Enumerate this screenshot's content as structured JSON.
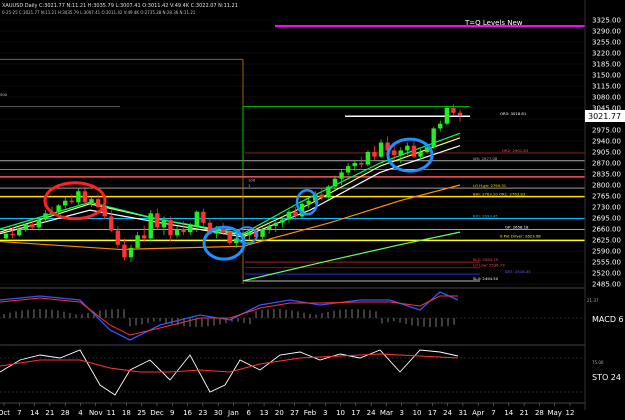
{
  "header": {
    "line1": "XAUUSD Daily C:3021.77 N:11.21 H:3035.79 L:3007.41 O:3011.42 V:49.4K C:3022.07 N:11.21",
    "line2": "0-25-25 C:3021.77 N:11.21 H:3035.79 L:3007.41 O:3011.42 V:49.4K O:2735.38 N:28.36 N:11.21"
  },
  "title_overlay": "T=Q Levels New",
  "current_price": "3021.77",
  "price_axis": {
    "labels": [
      "3325.00",
      "3290.00",
      "3255.00",
      "3220.00",
      "3185.00",
      "3150.00",
      "3115.00",
      "3080.00",
      "3045.00",
      "3010.00",
      "2975.00",
      "2940.00",
      "2905.00",
      "2870.00",
      "2835.00",
      "2800.00",
      "2765.00",
      "2730.00",
      "2695.00",
      "2660.00",
      "2625.00",
      "2590.00",
      "2555.00",
      "2520.00",
      "2485.00"
    ],
    "min": 2485,
    "max": 3325
  },
  "date_axis": {
    "labels": [
      "Oct",
      "7",
      "14",
      "21",
      "28",
      "4",
      "Nov",
      "11",
      "18",
      "25",
      "Dec",
      "9",
      "16",
      "23",
      "30",
      "Jan",
      "6",
      "13",
      "20",
      "27",
      "Feb",
      "3",
      "10",
      "17",
      "24",
      "Mar",
      "3",
      "10",
      "17",
      "24",
      "31",
      "Apr",
      "7",
      "14",
      "21",
      "28",
      "May",
      "12"
    ]
  },
  "level_labels": {
    "l3018": "OR3: 3018.81",
    "l2901": "OR2: 2901.83",
    "l2877": "WS: 2877.08",
    "l2790": "LO H.gh: 2790.31",
    "l2763": "BHI: 2763.10  OR1: 2763.83",
    "l2693": "BIO: 2693.45",
    "l2657": "OP: 2658.18",
    "l2627": "0 Pvt Driver: 2623.98",
    "l2554": "SL2: 2554.75",
    "l2541": "LO Low: 2536.73",
    "l2516": "SR7: 2516.35",
    "l2494": "SL4: 2494.50",
    "l500": "500",
    "l1": "1",
    "l100": "100"
  },
  "indicators": {
    "macd": {
      "label": "MACD 6",
      "value": "21.37"
    },
    "sto": {
      "label": "STO 24",
      "value": "75.00"
    }
  },
  "chart_data": {
    "type": "candlestick",
    "title": "XAUUSD Daily",
    "ylim": [
      2485,
      3325
    ],
    "candles": [
      [
        2630,
        2655,
        2625,
        2645
      ],
      [
        2645,
        2665,
        2630,
        2640
      ],
      [
        2640,
        2670,
        2635,
        2660
      ],
      [
        2660,
        2680,
        2650,
        2675
      ],
      [
        2675,
        2690,
        2660,
        2665
      ],
      [
        2665,
        2695,
        2655,
        2690
      ],
      [
        2690,
        2720,
        2680,
        2710
      ],
      [
        2710,
        2730,
        2700,
        2715
      ],
      [
        2715,
        2740,
        2705,
        2735
      ],
      [
        2735,
        2760,
        2725,
        2750
      ],
      [
        2750,
        2770,
        2740,
        2745
      ],
      [
        2745,
        2790,
        2735,
        2780
      ],
      [
        2780,
        2795,
        2740,
        2745
      ],
      [
        2745,
        2760,
        2730,
        2755
      ],
      [
        2755,
        2770,
        2725,
        2730
      ],
      [
        2730,
        2745,
        2690,
        2700
      ],
      [
        2700,
        2720,
        2650,
        2655
      ],
      [
        2655,
        2670,
        2600,
        2610
      ],
      [
        2610,
        2630,
        2560,
        2570
      ],
      [
        2570,
        2610,
        2555,
        2600
      ],
      [
        2600,
        2650,
        2595,
        2640
      ],
      [
        2640,
        2670,
        2620,
        2630
      ],
      [
        2630,
        2720,
        2620,
        2710
      ],
      [
        2710,
        2725,
        2660,
        2665
      ],
      [
        2665,
        2700,
        2640,
        2690
      ],
      [
        2690,
        2700,
        2620,
        2640
      ],
      [
        2640,
        2670,
        2630,
        2660
      ],
      [
        2660,
        2685,
        2640,
        2650
      ],
      [
        2650,
        2680,
        2640,
        2670
      ],
      [
        2670,
        2720,
        2650,
        2715
      ],
      [
        2715,
        2725,
        2670,
        2680
      ],
      [
        2680,
        2695,
        2640,
        2645
      ],
      [
        2645,
        2670,
        2630,
        2660
      ],
      [
        2660,
        2680,
        2640,
        2650
      ],
      [
        2650,
        2665,
        2610,
        2615
      ],
      [
        2615,
        2640,
        2600,
        2630
      ],
      [
        2630,
        2650,
        2620,
        2640
      ],
      [
        2640,
        2660,
        2625,
        2650
      ],
      [
        2650,
        2670,
        2625,
        2635
      ],
      [
        2635,
        2665,
        2625,
        2660
      ],
      [
        2660,
        2680,
        2645,
        2670
      ],
      [
        2670,
        2690,
        2650,
        2680
      ],
      [
        2680,
        2700,
        2665,
        2690
      ],
      [
        2690,
        2720,
        2680,
        2715
      ],
      [
        2715,
        2730,
        2690,
        2700
      ],
      [
        2700,
        2745,
        2695,
        2740
      ],
      [
        2740,
        2760,
        2725,
        2750
      ],
      [
        2750,
        2780,
        2740,
        2770
      ],
      [
        2770,
        2790,
        2750,
        2760
      ],
      [
        2760,
        2800,
        2755,
        2795
      ],
      [
        2795,
        2830,
        2785,
        2820
      ],
      [
        2820,
        2850,
        2800,
        2840
      ],
      [
        2840,
        2870,
        2830,
        2860
      ],
      [
        2860,
        2880,
        2845,
        2870
      ],
      [
        2870,
        2890,
        2855,
        2865
      ],
      [
        2865,
        2910,
        2860,
        2905
      ],
      [
        2905,
        2925,
        2880,
        2890
      ],
      [
        2890,
        2945,
        2885,
        2935
      ],
      [
        2935,
        2955,
        2900,
        2910
      ],
      [
        2910,
        2930,
        2880,
        2895
      ],
      [
        2895,
        2920,
        2870,
        2910
      ],
      [
        2910,
        2935,
        2895,
        2925
      ],
      [
        2925,
        2945,
        2885,
        2890
      ],
      [
        2890,
        2915,
        2880,
        2905
      ],
      [
        2905,
        2930,
        2900,
        2920
      ],
      [
        2920,
        2985,
        2915,
        2980
      ],
      [
        2980,
        3005,
        2970,
        2995
      ],
      [
        2995,
        3050,
        2990,
        3045
      ],
      [
        3045,
        3057,
        3020,
        3030
      ],
      [
        3030,
        3040,
        3000,
        3022
      ]
    ],
    "levels": [
      3018.81,
      2901.83,
      2877.08,
      2790.31,
      2763.1,
      2693.45,
      2658.18,
      2623.98,
      2554.75,
      2536.73,
      2516.35,
      2494.5
    ]
  }
}
